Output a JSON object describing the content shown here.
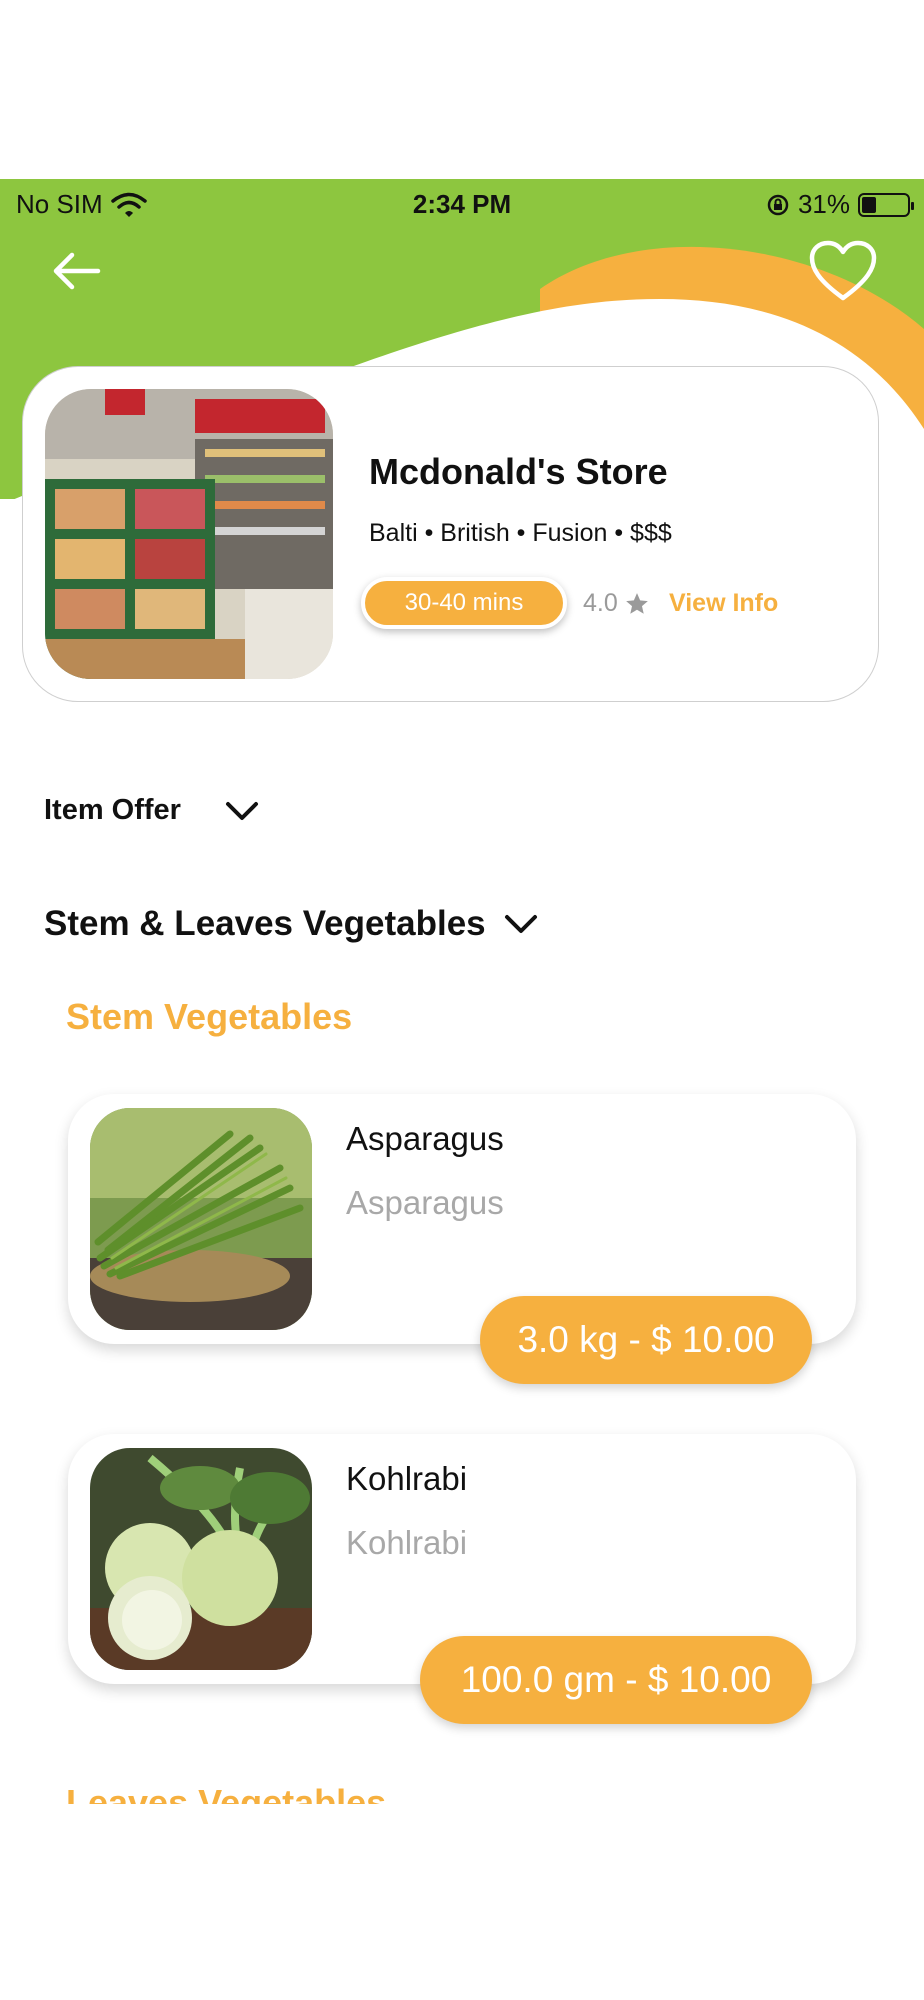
{
  "status_bar": {
    "carrier": "No SIM",
    "time": "2:34 PM",
    "battery": "31%"
  },
  "store": {
    "name": "Mcdonald's Store",
    "tags": "Balti • British • Fusion • $$$",
    "delivery_time": "30-40 mins",
    "rating": "4.0",
    "view_info": "View Info"
  },
  "sections": {
    "item_offer": "Item Offer",
    "category": "Stem & Leaves Vegetables",
    "stem_title": "Stem Vegetables",
    "leaves_title": "Leaves Vegetables"
  },
  "products": [
    {
      "name": "Asparagus",
      "subtitle": "Asparagus",
      "price": "3.0 kg - $ 10.00"
    },
    {
      "name": "Kohlrabi",
      "subtitle": "Kohlrabi",
      "price": "100.0 gm - $ 10.00"
    }
  ],
  "colors": {
    "header_green": "#8dc63f",
    "accent_orange": "#f6b03f"
  },
  "icons": [
    "wifi-icon",
    "orientation-lock-icon",
    "battery-icon",
    "back-arrow-icon",
    "heart-icon",
    "star-icon",
    "chevron-down-icon"
  ]
}
